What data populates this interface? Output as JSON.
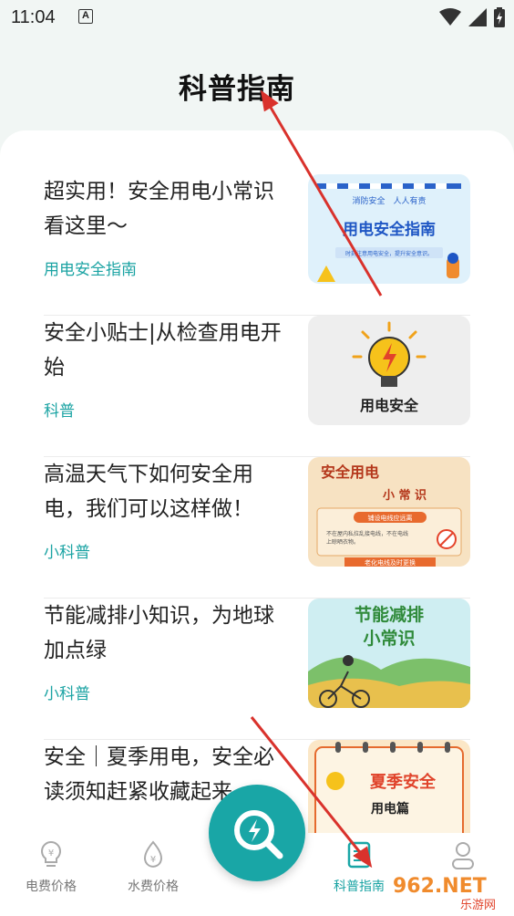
{
  "status_bar": {
    "time": "11:04",
    "notif_letter": "A"
  },
  "page": {
    "title": "科普指南"
  },
  "articles": [
    {
      "title": "超实用！安全用电小常识看这里～",
      "category": "用电安全指南",
      "thumb_text": {
        "top_line": "消防安全　人人有责",
        "heading": "用电安全指南",
        "sub": "时刻注意用电安全，提升安全意识。"
      }
    },
    {
      "title": "安全小贴士|从检查用电开始",
      "category": "科普",
      "thumb_text": {
        "heading": "用电安全"
      }
    },
    {
      "title": "高温天气下如何安全用电，我们可以这样做！",
      "category": "小科普",
      "thumb_text": {
        "heading": "安全用电",
        "sub": "小 常 识",
        "banner": "铺设电线应远离",
        "note1": "不在屋内私拉乱接电线，不在电线",
        "note2": "上晾晒衣物。",
        "footer": "老化电线及时更换"
      }
    },
    {
      "title": "节能减排小知识，为地球加点绿",
      "category": "小科普",
      "thumb_text": {
        "heading": "节能减排",
        "sub": "小常识"
      }
    },
    {
      "title": "安全｜夏季用电，安全必读须知赶紧收藏起来",
      "category": "",
      "thumb_text": {
        "heading": "夏季安全",
        "sub": "用电篇"
      }
    }
  ],
  "bottom_nav": [
    {
      "label": "电费价格",
      "icon": "bulb-yen-icon",
      "active": false
    },
    {
      "label": "水费价格",
      "icon": "water-drop-yen-icon",
      "active": false
    },
    {
      "label": "科普指南",
      "icon": "document-icon",
      "active": true
    },
    {
      "label": "",
      "icon": "user-icon",
      "active": false
    }
  ],
  "fab": {
    "icon": "search-lightning-icon"
  },
  "watermark": {
    "text": "962.NET",
    "sub": "乐游网"
  },
  "colors": {
    "accent": "#19a6a6",
    "arrow": "#d9322c",
    "background": "#f1f6f4"
  }
}
